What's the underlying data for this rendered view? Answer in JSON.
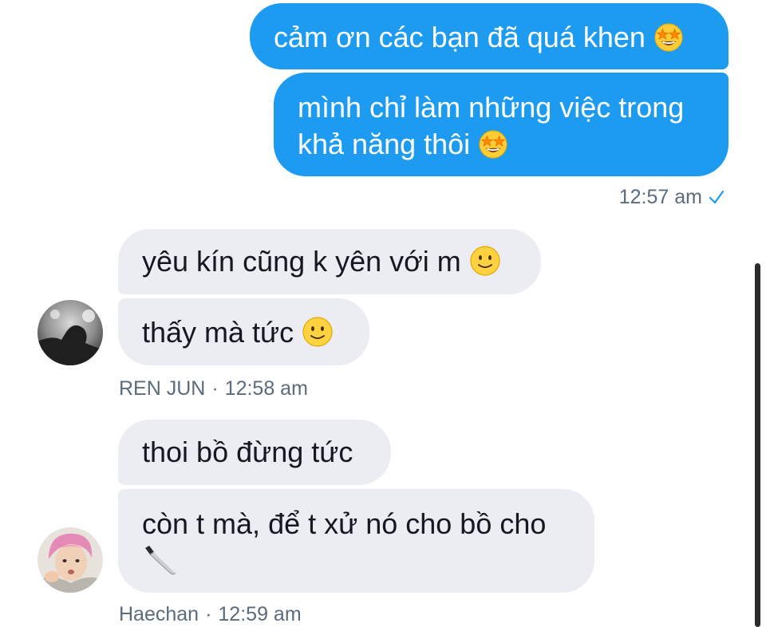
{
  "conversation": {
    "outgoing": [
      {
        "text": "cảm ơn các bạn đã quá khen",
        "emoji": "star-struck-emoji"
      },
      {
        "lines": [
          "mình chỉ làm những việc trong",
          "khả năng thôi"
        ],
        "emoji": "star-struck-emoji"
      }
    ],
    "outgoing_meta": {
      "time": "12:57 am",
      "status_icon": "read-check-icon"
    },
    "group1": {
      "messages": [
        {
          "text": "yêu kín cũng k yên với m",
          "emoji": "slightly-smiling-emoji"
        },
        {
          "text": "thấy mà tức",
          "emoji": "slightly-smiling-emoji"
        }
      ],
      "sender": "REN JUN",
      "time": "12:58 am"
    },
    "group2": {
      "messages": [
        {
          "text": "thoi bồ đừng tức"
        },
        {
          "text": "còn t mà, để t xử nó cho bồ cho",
          "emoji": "kitchen-knife-emoji"
        }
      ],
      "sender": "Haechan",
      "time": "12:59 am"
    }
  },
  "colors": {
    "outgoing_bubble": "#1d9bf0",
    "incoming_bubble": "#ebedf3",
    "meta_text": "#5b6b7c"
  }
}
